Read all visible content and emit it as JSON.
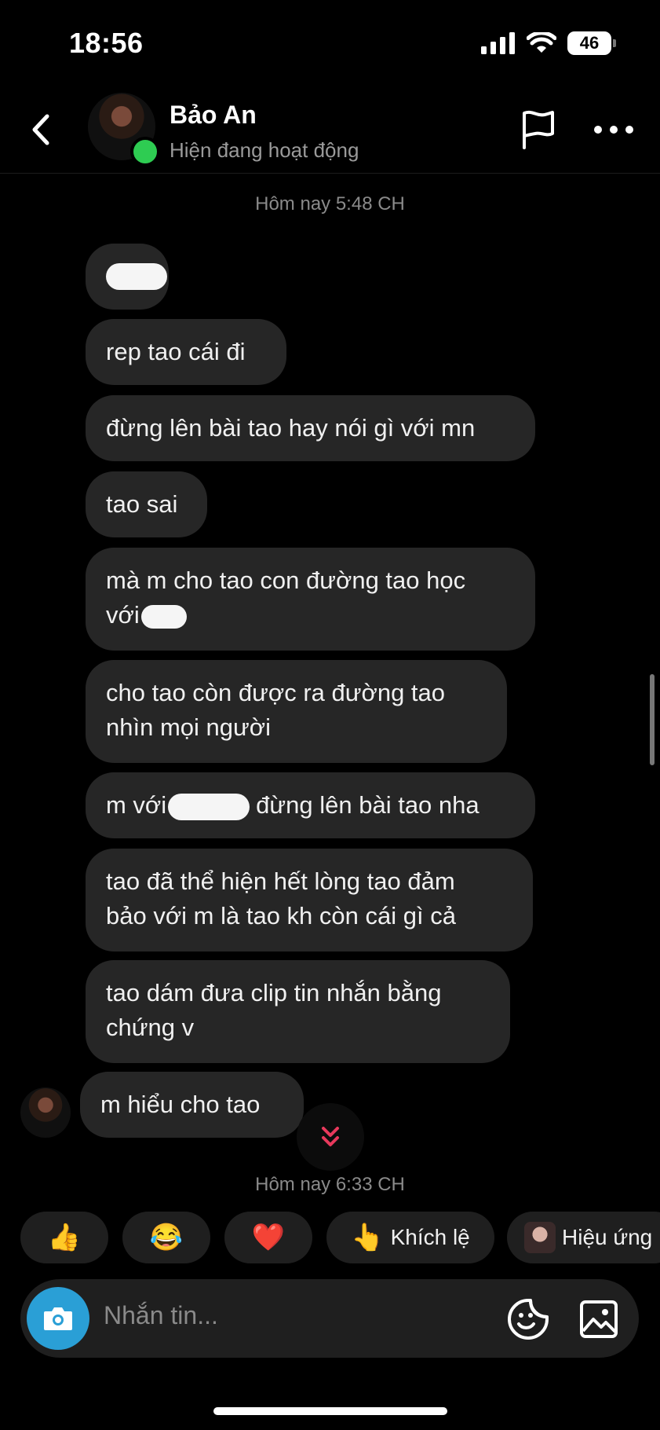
{
  "status_bar": {
    "time": "18:56",
    "battery": "46"
  },
  "header": {
    "name": "Bảo An",
    "status": "Hiện đang hoạt động",
    "icons": {
      "back": "chevron-left-icon",
      "flag": "flag-icon",
      "more": "more-dots-icon"
    }
  },
  "timestamps": [
    "Hôm nay 5:48 CH",
    "Hôm nay 6:33 CH"
  ],
  "messages": [
    {
      "text": ""
    },
    {
      "text": "rep tao cái đi"
    },
    {
      "text": "đừng lên bài tao hay nói gì với mn"
    },
    {
      "text": "tao sai"
    },
    {
      "text": "mà m cho tao con đường tao học",
      "text2": "với"
    },
    {
      "text": "cho tao còn được ra đường tao\nnhìn mọi người"
    },
    {
      "text": "m với",
      "text2": "đừng lên bài tao nha"
    },
    {
      "text": "tao đã thể hiện hết lòng tao đảm\nbảo với m là tao kh còn cái gì cả"
    },
    {
      "text": "tao dám đưa clip tin nhắn bằng\nchứng v"
    },
    {
      "text": "m hiểu cho tao"
    }
  ],
  "quick_reactions": [
    {
      "emoji": "👍",
      "label": ""
    },
    {
      "emoji": "😂",
      "label": ""
    },
    {
      "emoji": "❤️",
      "label": ""
    },
    {
      "emoji": "👆",
      "label": "Khích lệ"
    },
    {
      "emoji": "",
      "label": "Hiệu ứng"
    }
  ],
  "composer": {
    "placeholder": "Nhắn tin..."
  },
  "colors": {
    "background": "#000000",
    "bubble": "#262626",
    "online": "#2ecc52",
    "camera": "#2a9fd6"
  }
}
